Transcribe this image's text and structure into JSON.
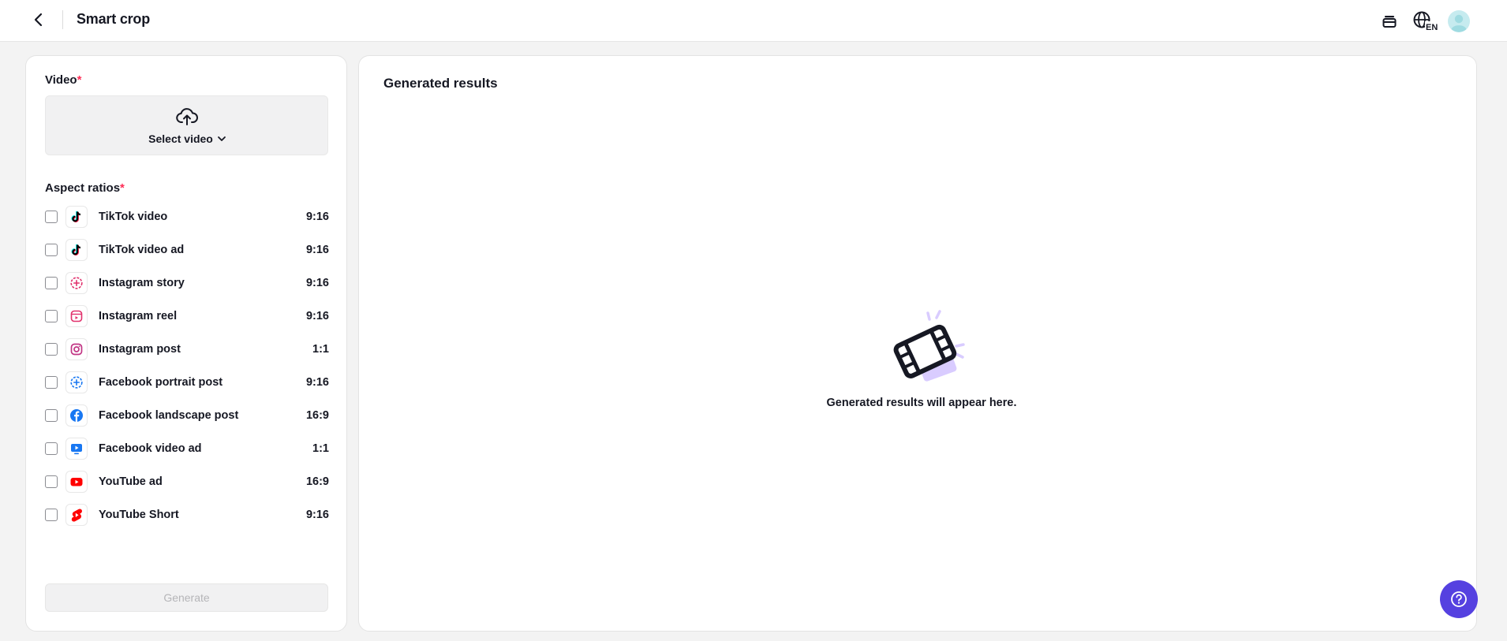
{
  "header": {
    "title": "Smart crop",
    "language_code": "EN",
    "icons": [
      "back-arrow-icon",
      "layers-icon",
      "globe-icon",
      "avatar"
    ]
  },
  "left_panel": {
    "video_label": "Video",
    "required_mark": "*",
    "select_video_label": "Select video",
    "aspect_label": "Aspect ratios",
    "ratios": [
      {
        "label": "TikTok video",
        "ratio": "9:16",
        "icon": "tiktok-icon",
        "checked": false
      },
      {
        "label": "TikTok video ad",
        "ratio": "9:16",
        "icon": "tiktok-icon",
        "checked": false
      },
      {
        "label": "Instagram story",
        "ratio": "9:16",
        "icon": "instagram-story-icon",
        "checked": false
      },
      {
        "label": "Instagram reel",
        "ratio": "9:16",
        "icon": "instagram-reel-icon",
        "checked": false
      },
      {
        "label": "Instagram post",
        "ratio": "1:1",
        "icon": "instagram-icon",
        "checked": false
      },
      {
        "label": "Facebook portrait post",
        "ratio": "9:16",
        "icon": "facebook-story-icon",
        "checked": false
      },
      {
        "label": "Facebook landscape post",
        "ratio": "16:9",
        "icon": "facebook-icon",
        "checked": false
      },
      {
        "label": "Facebook video ad",
        "ratio": "1:1",
        "icon": "facebook-video-icon",
        "checked": false
      },
      {
        "label": "YouTube ad",
        "ratio": "16:9",
        "icon": "youtube-icon",
        "checked": false
      },
      {
        "label": "YouTube Short",
        "ratio": "9:16",
        "icon": "youtube-shorts-icon",
        "checked": false
      }
    ],
    "generate_label": "Generate"
  },
  "right_panel": {
    "title": "Generated results",
    "empty_text": "Generated results will appear here."
  },
  "colors": {
    "accent": "#5541e0",
    "required": "#fe2c55",
    "illustration": "#d9ccff"
  }
}
